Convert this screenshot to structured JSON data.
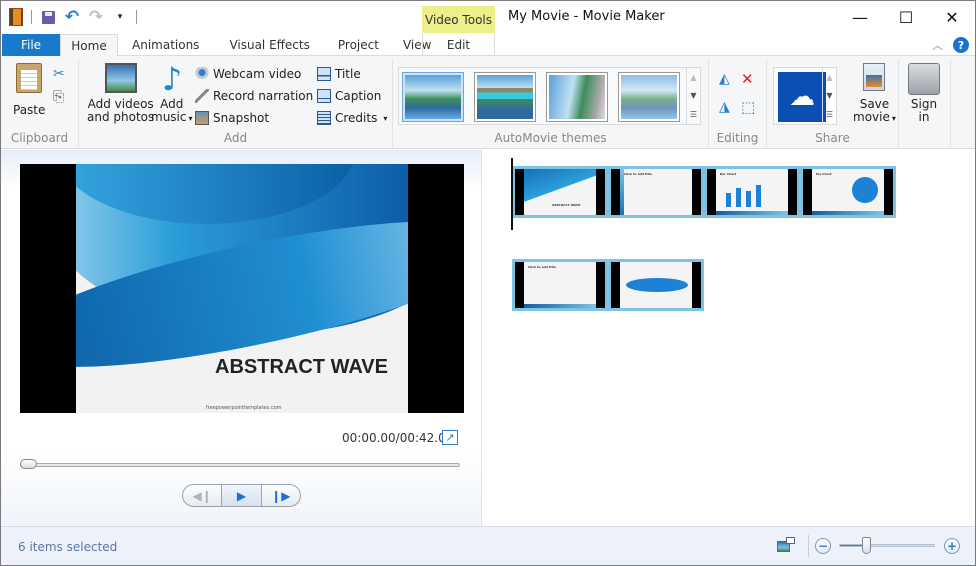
{
  "window": {
    "title": "My Movie - Movie Maker",
    "contextual_tab_group": "Video Tools",
    "controls": {
      "minimize": "—",
      "maximize": "☐",
      "close": "✕"
    }
  },
  "quick_access": {
    "icons": [
      "app-icon",
      "save-icon",
      "undo-icon",
      "redo-icon",
      "customize-icon"
    ],
    "undo_glyph": "↶",
    "redo_glyph": "↷",
    "more_glyph": "▾"
  },
  "tabs": [
    {
      "label": "File",
      "active": false
    },
    {
      "label": "Home",
      "active": true
    },
    {
      "label": "Animations",
      "active": false
    },
    {
      "label": "Visual Effects",
      "active": false
    },
    {
      "label": "Project",
      "active": false
    },
    {
      "label": "View",
      "active": false
    },
    {
      "label": "Edit",
      "active": false,
      "contextual": true
    }
  ],
  "ribbon_right": {
    "collapse_glyph": "︿",
    "help_glyph": "?"
  },
  "ribbon": {
    "clipboard": {
      "label": "Clipboard",
      "paste": "Paste",
      "cut_glyph": "✂",
      "copy_glyph": "⎘"
    },
    "add": {
      "label": "Add",
      "add_videos_line1": "Add videos",
      "add_videos_line2": "and photos",
      "add_music_line1": "Add",
      "add_music_line2": "music",
      "webcam": "Webcam video",
      "narration": "Record narration",
      "snapshot": "Snapshot",
      "title": "Title",
      "caption": "Caption",
      "credits": "Credits",
      "caret": "▾",
      "note_glyph": "♪"
    },
    "themes": {
      "label": "AutoMovie themes",
      "items": [
        "Default",
        "Contemporary",
        "Cinematic",
        "Fade"
      ],
      "selected_index": 0,
      "scroll_up": "▲",
      "scroll_down": "▼",
      "more": "☰"
    },
    "editing": {
      "label": "Editing",
      "rotate_left_glyph": "◭",
      "remove_glyph": "✕",
      "rotate_right_glyph": "◮",
      "select_all_glyph": "⬚"
    },
    "share": {
      "label": "Share",
      "cloud_glyph": "☁",
      "save_movie_line1": "Save",
      "save_movie_line2": "movie"
    },
    "signin": {
      "line1": "Sign",
      "line2": "in"
    }
  },
  "preview": {
    "slide_title": "ABSTRACT WAVE",
    "slide_url": "freepowerpointtemplates.com",
    "time_display": "00:00.00/00:42.00",
    "fullscreen_glyph": "↗",
    "seek_position_fraction": 0,
    "transport": {
      "prev": "◀❙",
      "play": "▶",
      "next": "❙▶"
    }
  },
  "storyboard": {
    "clips": [
      {
        "kind": "title",
        "caption": "ABSTRACT WAVE"
      },
      {
        "kind": "bullets",
        "caption": "Click to add title"
      },
      {
        "kind": "bar-chart",
        "caption": "Bar Chart"
      },
      {
        "kind": "pie-chart",
        "caption": "Pie Chart"
      },
      {
        "kind": "two-column",
        "caption": "Click to add title"
      },
      {
        "kind": "ellipse",
        "caption": ""
      }
    ]
  },
  "status": {
    "text": "6 items selected",
    "zoom_minus": "−",
    "zoom_plus": "+",
    "zoom_fraction": 0.28
  }
}
